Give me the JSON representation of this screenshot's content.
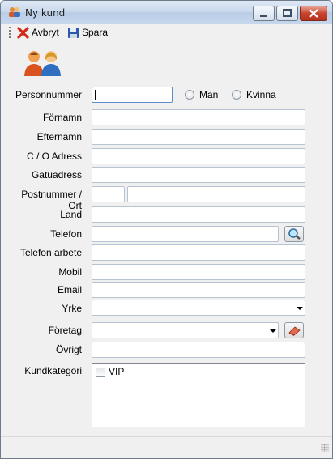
{
  "window": {
    "title": "Ny kund"
  },
  "toolbar": {
    "cancel_label": "Avbryt",
    "save_label": "Spara"
  },
  "form": {
    "personnummer": {
      "label": "Personnummer",
      "value": ""
    },
    "gender": {
      "option_man": "Man",
      "option_woman": "Kvinna",
      "selected": ""
    },
    "fornamn": {
      "label": "Förnamn",
      "value": ""
    },
    "efternamn": {
      "label": "Efternamn",
      "value": ""
    },
    "co_adress": {
      "label": "C / O Adress",
      "value": ""
    },
    "gatuadress": {
      "label": "Gatuadress",
      "value": ""
    },
    "postnummer_ort": {
      "label": "Postnummer / Ort",
      "postnummer": "",
      "ort": ""
    },
    "land": {
      "label": "Land",
      "value": ""
    },
    "telefon": {
      "label": "Telefon",
      "value": ""
    },
    "telefon_arbete": {
      "label": "Telefon arbete",
      "value": ""
    },
    "mobil": {
      "label": "Mobil",
      "value": ""
    },
    "email": {
      "label": "Email",
      "value": ""
    },
    "yrke": {
      "label": "Yrke",
      "value": ""
    },
    "foretag": {
      "label": "Företag",
      "value": ""
    },
    "ovrigt": {
      "label": "Övrigt",
      "value": ""
    },
    "kundkategori": {
      "label": "Kundkategori",
      "items": [
        {
          "label": "VIP",
          "checked": false
        }
      ]
    }
  },
  "icons": {
    "title": "customers-icon",
    "cancel": "red-x-icon",
    "save": "floppy-disk-icon",
    "logo": "two-people-icon",
    "phone_lookup": "magnifier-icon",
    "company_action": "eraser-icon"
  },
  "colors": {
    "titlebar": "#c9d9ec",
    "close_button": "#c9432e",
    "field_border": "#b5c3d3"
  }
}
